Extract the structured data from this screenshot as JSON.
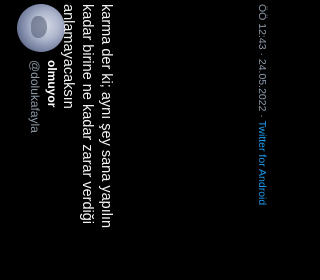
{
  "tweet": {
    "display_name": "olmuyor",
    "handle": "@dolukafayla",
    "text": "karma der ki; aynı şey sana yapılın\nkadar birine ne kadar zarar verdiği\nanlamayacaksın",
    "time": "ÖÖ 12:43",
    "separator": " · ",
    "date": "24.05.2022",
    "source": "Twitter for Android"
  },
  "colors": {
    "background": "#000000",
    "text": "#e7e9ea",
    "secondary_text": "#8b98a5",
    "link": "#1d9bf0"
  }
}
